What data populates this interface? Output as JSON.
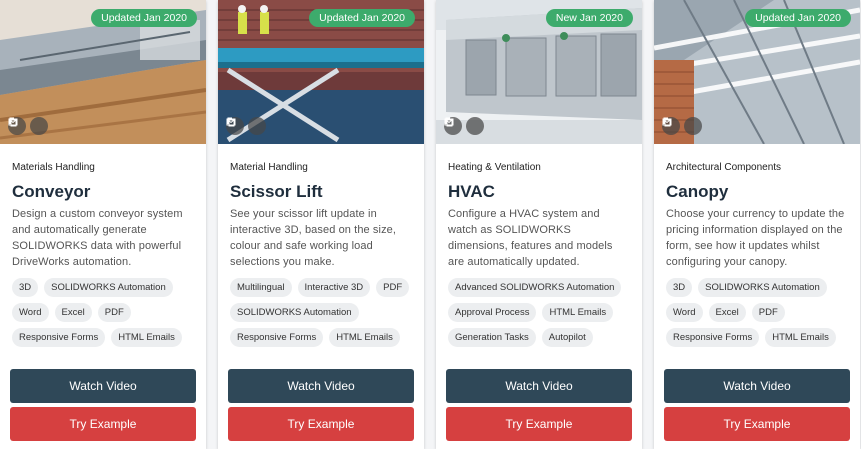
{
  "colors": {
    "badge_green": "#3dab6c",
    "watch_button": "#2f4858",
    "try_button": "#d64040",
    "tag_bg": "#eceef0"
  },
  "share_icons": [
    "mail-icon",
    "copy-link-icon"
  ],
  "cards": [
    {
      "badge": "Updated Jan 2020",
      "category": "Materials Handling",
      "title": "Conveyor",
      "description": "Design a custom conveyor system and automatically generate SOLIDWORKS data with powerful DriveWorks automation.",
      "tags": [
        "3D",
        "SOLIDWORKS Automation",
        "Word",
        "Excel",
        "PDF",
        "Responsive Forms",
        "HTML Emails"
      ],
      "watch_label": "Watch Video",
      "try_label": "Try Example"
    },
    {
      "badge": "Updated Jan 2020",
      "category": "Material Handling",
      "title": "Scissor Lift",
      "description": "See your scissor lift update in interactive 3D, based on the size, colour and safe working load selections you make.",
      "tags": [
        "Multilingual",
        "Interactive 3D",
        "PDF",
        "SOLIDWORKS Automation",
        "Responsive Forms",
        "HTML Emails"
      ],
      "watch_label": "Watch Video",
      "try_label": "Try Example"
    },
    {
      "badge": "New Jan 2020",
      "category": "Heating & Ventilation",
      "title": "HVAC",
      "description": "Configure a HVAC system and watch as SOLIDWORKS dimensions, features and models are automatically updated.",
      "tags": [
        "Advanced SOLIDWORKS Automation",
        "Approval Process",
        "HTML Emails",
        "Generation Tasks",
        "Autopilot"
      ],
      "watch_label": "Watch Video",
      "try_label": "Try Example"
    },
    {
      "badge": "Updated Jan 2020",
      "category": "Architectural Components",
      "title": "Canopy",
      "description": "Choose your currency to update the pricing information displayed on the form, see how it updates whilst configuring your canopy.",
      "tags": [
        "3D",
        "SOLIDWORKS Automation",
        "Word",
        "Excel",
        "PDF",
        "Responsive Forms",
        "HTML Emails"
      ],
      "watch_label": "Watch Video",
      "try_label": "Try Example"
    }
  ]
}
